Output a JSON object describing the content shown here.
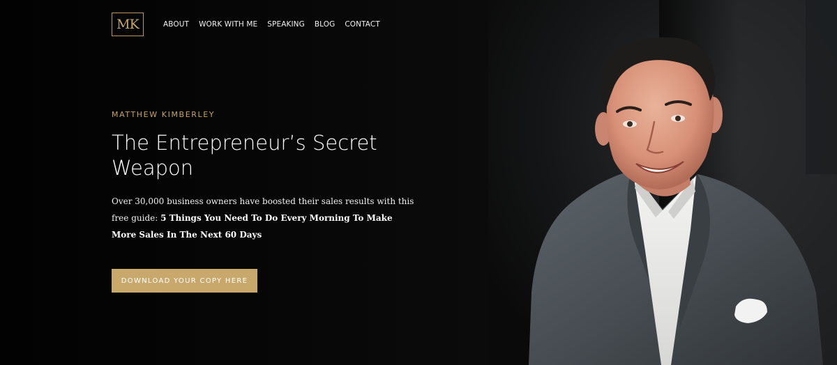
{
  "brand": {
    "logo_text": "MK",
    "accent_color": "#c9a86c"
  },
  "nav": {
    "items": [
      {
        "label": "ABOUT"
      },
      {
        "label": "WORK WITH ME"
      },
      {
        "label": "SPEAKING"
      },
      {
        "label": "BLOG"
      },
      {
        "label": "CONTACT"
      }
    ]
  },
  "hero": {
    "eyebrow": "MATTHEW KIMBERLEY",
    "headline": "The Entrepreneur’s Secret Weapon",
    "intro_text": "Over 30,000 business owners have boosted their sales results with this free guide: ",
    "intro_bold": "5 Things You Need To Do Every Morning To Make More Sales In The Next 60 Days",
    "cta_label": "DOWNLOAD YOUR COPY HERE"
  },
  "portrait": {
    "subject": "smiling man in grey blazer",
    "icon": "person-photo"
  }
}
